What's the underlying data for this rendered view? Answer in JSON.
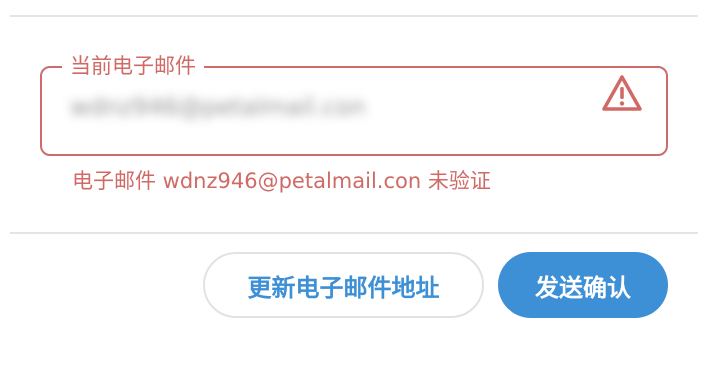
{
  "email_field": {
    "legend": "当前电子邮件",
    "value": "wdnz946@petalmail.con",
    "warning_icon": "warning-triangle-icon"
  },
  "error_message": "电子邮件 wdnz946@petalmail.con 未验证",
  "buttons": {
    "update_label": "更新电子邮件地址",
    "send_label": "发送确认"
  },
  "colors": {
    "error": "#d06a66",
    "accent": "#3d8fd6",
    "divider": "#e4e4e4"
  }
}
